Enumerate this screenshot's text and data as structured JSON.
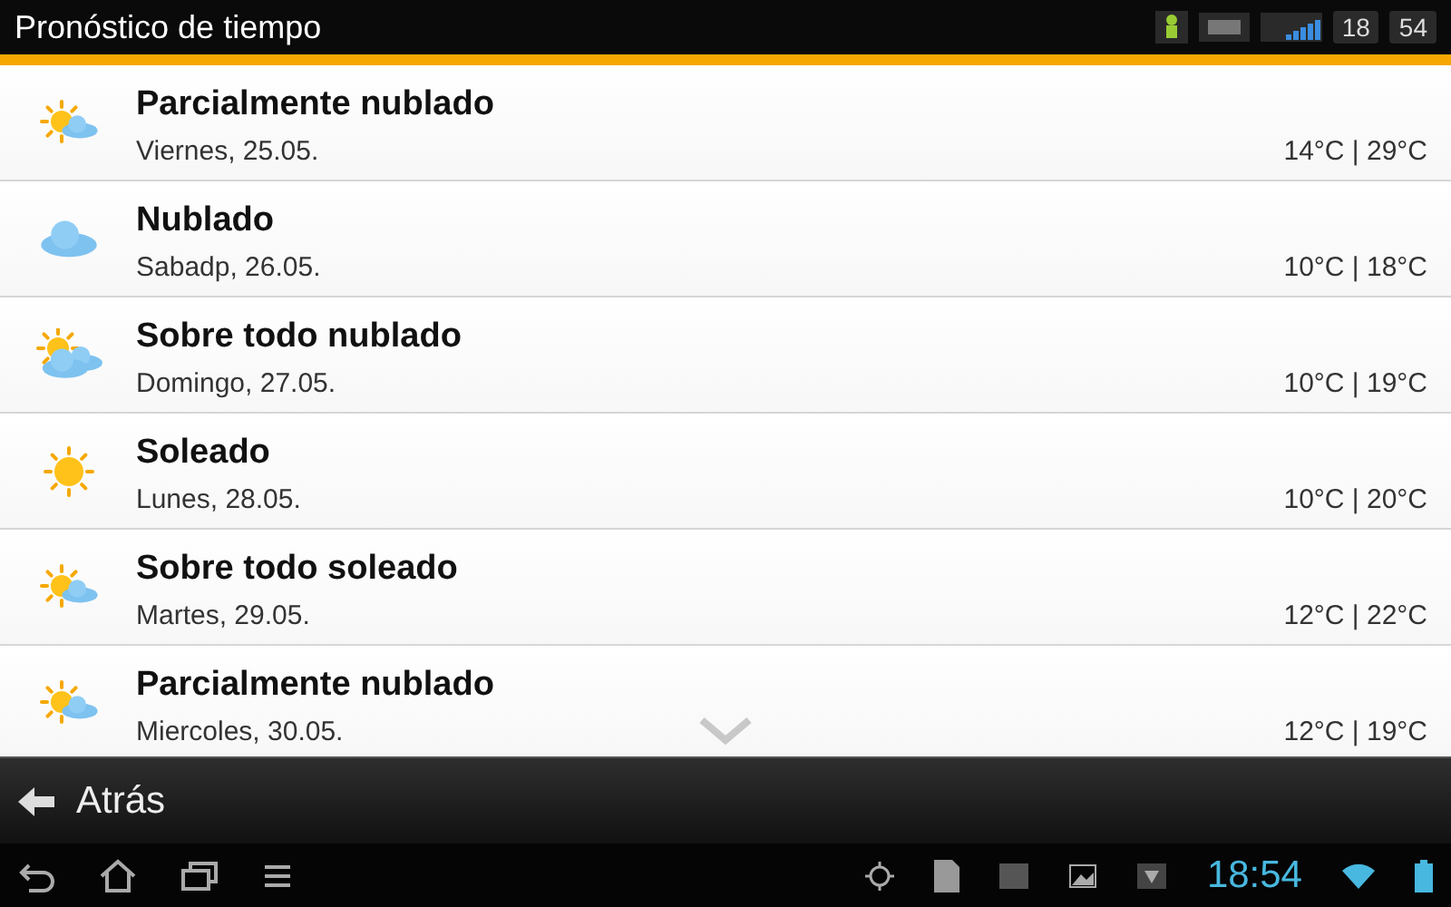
{
  "title_bar": {
    "title": "Pronóstico de tiempo",
    "clock_hours": "18",
    "clock_minutes": "54"
  },
  "forecast": [
    {
      "kind": "partly",
      "condition": "Parcialmente nublado",
      "date": "Viernes, 25.05.",
      "temps": "14°C | 29°C"
    },
    {
      "kind": "cloudy",
      "condition": "Nublado",
      "date": "Sabadp, 26.05.",
      "temps": "10°C | 18°C"
    },
    {
      "kind": "mostly-cloudy",
      "condition": "Sobre todo nublado",
      "date": "Domingo, 27.05.",
      "temps": "10°C | 19°C"
    },
    {
      "kind": "sunny",
      "condition": "Soleado",
      "date": "Lunes, 28.05.",
      "temps": "10°C | 20°C"
    },
    {
      "kind": "partly",
      "condition": "Sobre todo soleado",
      "date": "Martes, 29.05.",
      "temps": "12°C | 22°C"
    },
    {
      "kind": "partly",
      "condition": "Parcialmente nublado",
      "date": "Miercoles, 30.05.",
      "temps": "12°C | 19°C"
    }
  ],
  "back_bar": {
    "label": "Atrás"
  },
  "system_bar": {
    "clock": "18:54"
  }
}
